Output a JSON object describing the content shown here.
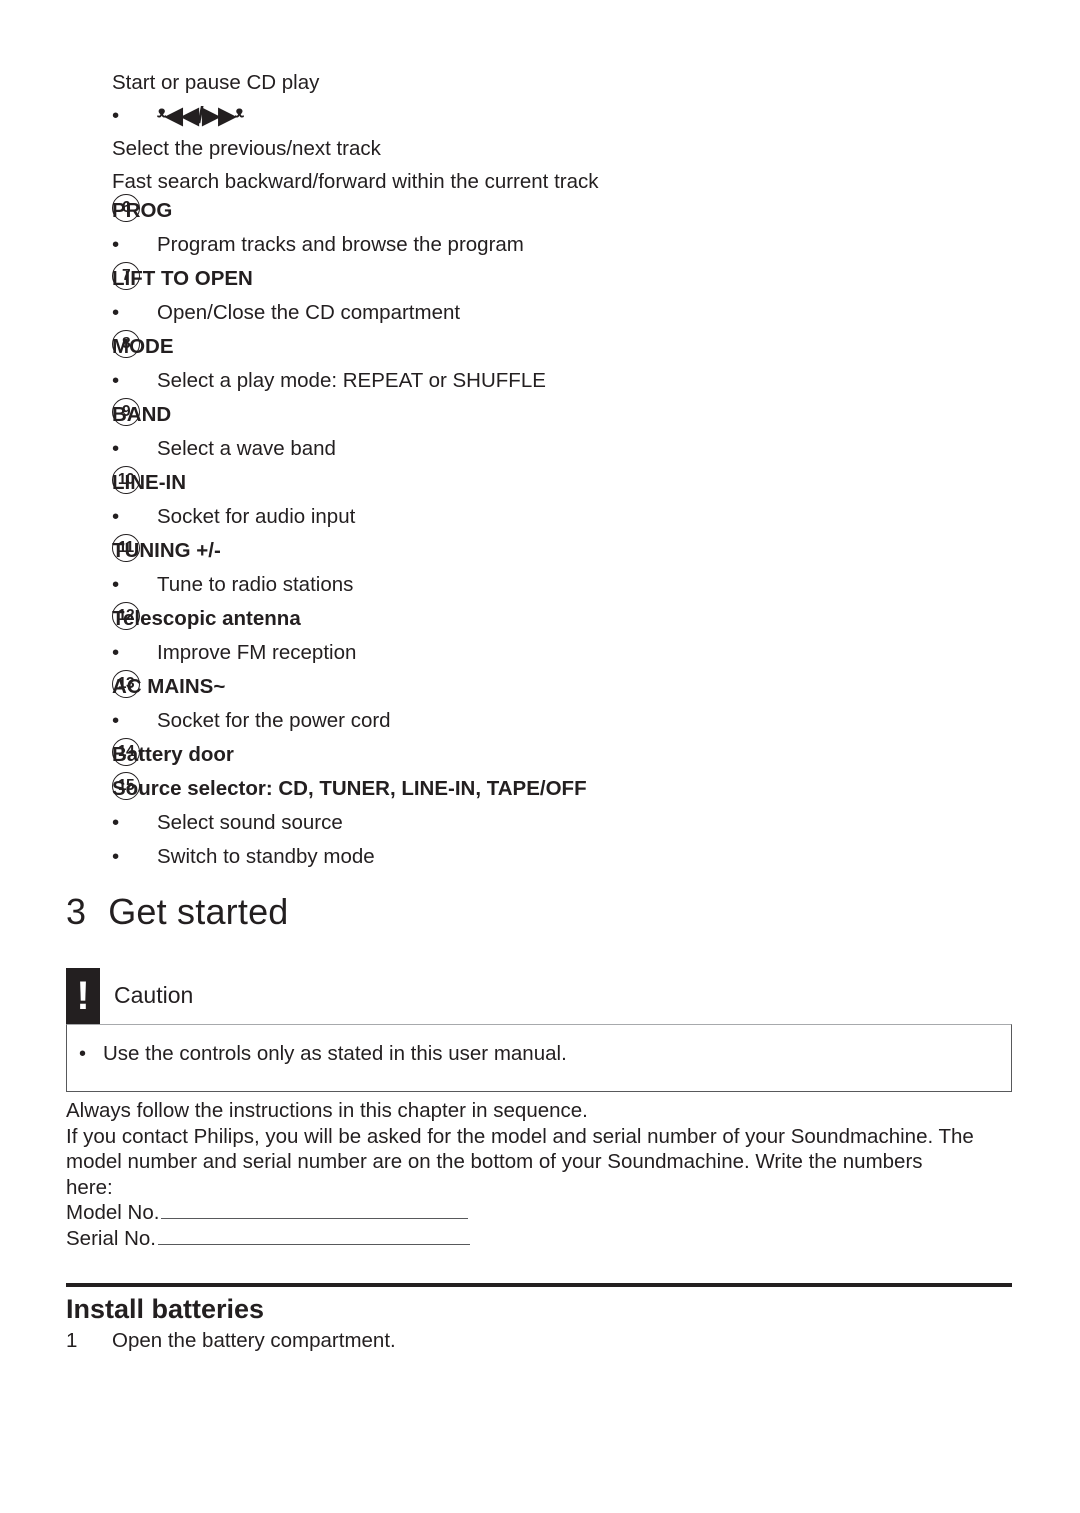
{
  "top_continuation": {
    "lines": [
      "Start or pause CD play"
    ],
    "transport_bullet": "•",
    "transport_glyphs": "ᵜ◀◀/▶▶ᵜ",
    "lines_after": [
      "Select the previous/next track",
      "Fast search backward/forward within the current track"
    ]
  },
  "controls": [
    {
      "number": "6",
      "title": "PROG",
      "bullets": [
        "Program tracks and browse the program"
      ]
    },
    {
      "number": "7",
      "title": "LIFT TO OPEN",
      "bullets": [
        "Open/Close the CD compartment"
      ]
    },
    {
      "number": "8",
      "title": "MODE",
      "bullets": [
        "Select a play mode: REPEAT or SHUFFLE"
      ]
    },
    {
      "number": "9",
      "title": "BAND",
      "bullets": [
        "Select a wave band"
      ]
    },
    {
      "number": "10",
      "title": "LINE-IN",
      "bullets": [
        "Socket for audio input"
      ]
    },
    {
      "number": "11",
      "title": "TUNING +/-",
      "bullets": [
        "Tune to radio stations"
      ]
    },
    {
      "number": "12",
      "title": "Telescopic antenna",
      "bullets": [
        "Improve FM reception"
      ]
    },
    {
      "number": "13",
      "title": "AC MAINS~",
      "bullets": [
        "Socket for the power cord"
      ]
    },
    {
      "number": "14",
      "title": "Battery door",
      "bullets": []
    },
    {
      "number": "15",
      "title": "Source selector: CD, TUNER, LINE-IN, TAPE/OFF",
      "bullets": [
        "Select sound source",
        "Switch to standby mode"
      ]
    }
  ],
  "chapter": {
    "number": "3",
    "title": "Get started"
  },
  "caution": {
    "badge_glyph": "!",
    "title": "Caution",
    "bullet": "•",
    "text": "Use the controls only as stated in this user manual."
  },
  "paragraphs": [
    "Always follow the instructions in this chapter in sequence.",
    "If you contact Philips, you will be asked for the model and serial number of your Soundmachine. The",
    "model number and serial number are on the bottom of your Soundmachine. Write the numbers",
    "here:"
  ],
  "fill_in": {
    "model_label": "Model No.",
    "serial_label": "Serial No."
  },
  "section": {
    "title": "Install batteries",
    "steps": [
      {
        "number": "1",
        "text": "Open the battery compartment."
      }
    ]
  },
  "colors": {
    "text": "#231f20",
    "page_background": "#ffffff",
    "rule": "#231f20",
    "note_border": "#58595b",
    "badge_background": "#231f20"
  }
}
